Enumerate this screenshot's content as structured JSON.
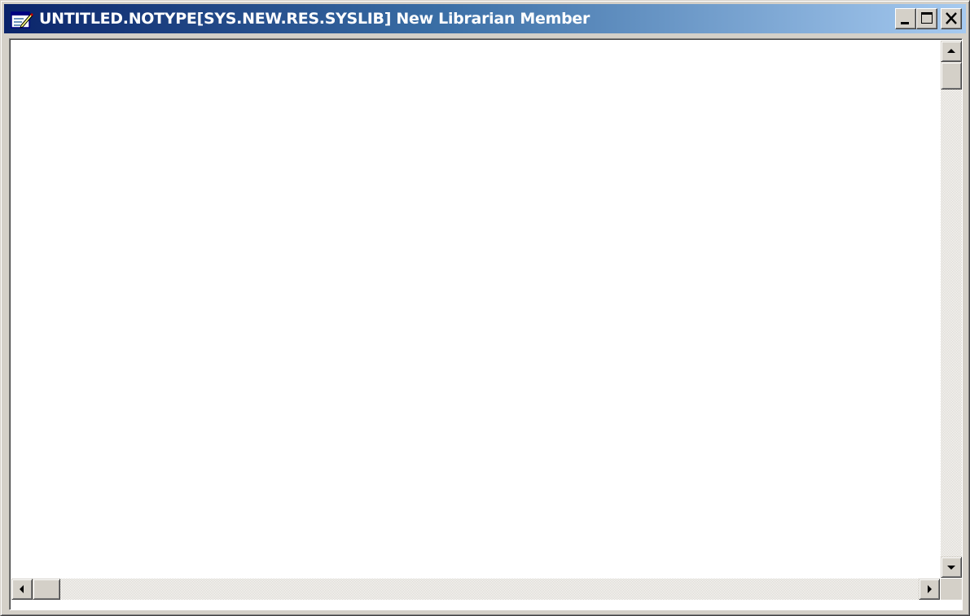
{
  "window": {
    "title": "UNTITLED.NOTYPE[SYS.NEW.RES.SYSLIB] New Librarian Member",
    "icon": "notepad-edit-icon"
  },
  "titlebar_buttons": {
    "minimize_icon": "minimize-icon",
    "maximize_icon": "maximize-icon",
    "close_icon": "close-icon"
  },
  "editor": {
    "content": ""
  },
  "scrollbars": {
    "vertical": {
      "up_icon": "arrow-up-icon",
      "down_icon": "arrow-down-icon"
    },
    "horizontal": {
      "left_icon": "arrow-left-icon",
      "right_icon": "arrow-right-icon"
    }
  },
  "colors": {
    "titlebar_start": "#0a246a",
    "titlebar_end": "#a6caf0",
    "chrome": "#d4d0c8"
  }
}
